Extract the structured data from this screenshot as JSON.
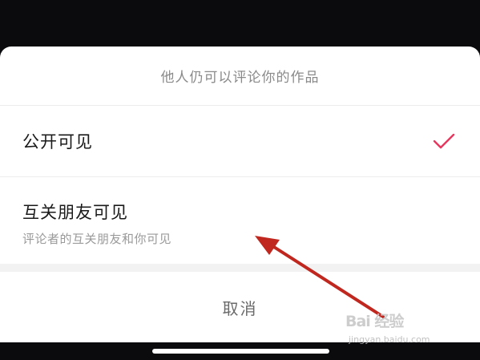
{
  "sheet": {
    "header": "他人仍可以评论你的作品",
    "options": [
      {
        "label": "公开可见",
        "selected": true
      },
      {
        "label": "互关朋友可见",
        "description": "评论者的互关朋友和你可见",
        "selected": false
      }
    ],
    "cancel_label": "取消"
  },
  "watermark": {
    "logo_text": "Bai 经验",
    "url": "jingyan.baidu.com"
  },
  "colors": {
    "check_accent": "#e8365e",
    "annotation_arrow": "#c0281f"
  },
  "icons": {
    "check": "check-icon"
  }
}
